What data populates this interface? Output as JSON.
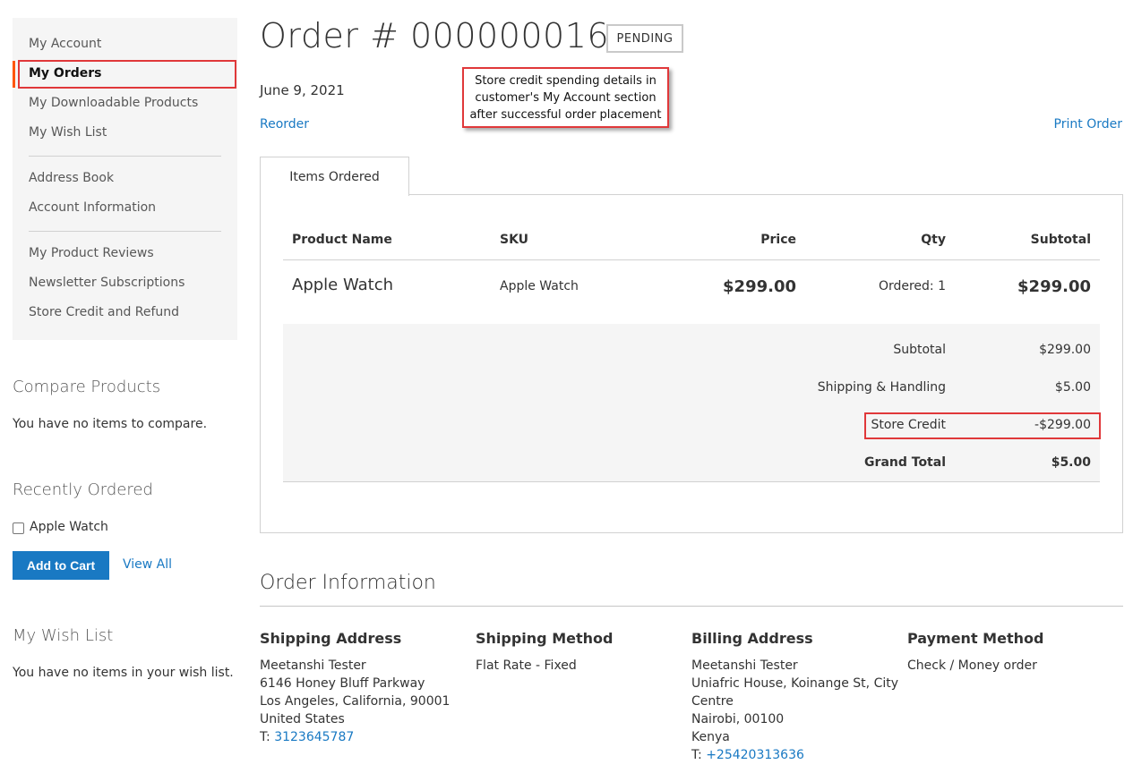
{
  "sidebar": {
    "nav": [
      {
        "label": "My Account"
      },
      {
        "label": "My Orders"
      },
      {
        "label": "My Downloadable Products"
      },
      {
        "label": "My Wish List"
      },
      {
        "label": "Address Book"
      },
      {
        "label": "Account Information"
      },
      {
        "label": "My Product Reviews"
      },
      {
        "label": "Newsletter Subscriptions"
      },
      {
        "label": "Store Credit and Refund"
      }
    ],
    "compare": {
      "title": "Compare Products",
      "empty": "You have no items to compare."
    },
    "recent": {
      "title": "Recently Ordered",
      "item": "Apple Watch",
      "add_to_cart": "Add to Cart",
      "view_all": "View All"
    },
    "wishlist": {
      "title": "My Wish List",
      "empty": "You have no items in your wish list."
    }
  },
  "order": {
    "title": "Order # 000000016",
    "status": "PENDING",
    "date": "June 9, 2021",
    "reorder": "Reorder",
    "print": "Print Order"
  },
  "callout": {
    "lines": [
      "Store credit spending details in",
      "customer's My Account section",
      "after successful order placement"
    ],
    "color": "#e0383a"
  },
  "items": {
    "tab": "Items Ordered",
    "headers": {
      "name": "Product Name",
      "sku": "SKU",
      "price": "Price",
      "qty": "Qty",
      "subtotal": "Subtotal"
    },
    "rows": [
      {
        "name": "Apple Watch",
        "sku": "Apple Watch",
        "price": "$299.00",
        "qty": "Ordered: 1",
        "subtotal": "$299.00"
      }
    ],
    "totals": [
      {
        "label": "Subtotal",
        "value": "$299.00"
      },
      {
        "label": "Shipping & Handling",
        "value": "$5.00"
      },
      {
        "label": "Store Credit",
        "value": "-$299.00"
      },
      {
        "label": "Grand Total",
        "value": "$5.00"
      }
    ]
  },
  "info": {
    "title": "Order Information",
    "shipping_address": {
      "title": "Shipping Address",
      "lines": [
        "Meetanshi Tester",
        "6146 Honey Bluff Parkway",
        "Los Angeles, California, 90001",
        "United States"
      ],
      "phone_prefix": "T: ",
      "phone": "3123645787"
    },
    "shipping_method": {
      "title": "Shipping Method",
      "value": "Flat Rate - Fixed"
    },
    "billing_address": {
      "title": "Billing Address",
      "lines": [
        "Meetanshi Tester",
        "Uniafric House, Koinange St, City",
        "Centre",
        "Nairobi, 00100",
        "Kenya"
      ],
      "phone_prefix": "T: ",
      "phone": "+25420313636"
    },
    "payment_method": {
      "title": "Payment Method",
      "value": "Check / Money order"
    }
  },
  "colors": {
    "link": "#1979c3",
    "accent": "#ff5501",
    "highlight": "#e0383a",
    "button": "#1979c3"
  }
}
